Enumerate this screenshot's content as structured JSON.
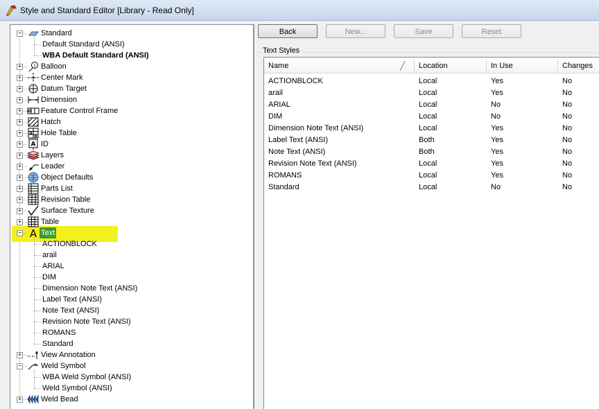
{
  "window": {
    "title": "Style and Standard Editor [Library - Read Only]"
  },
  "toolbar": {
    "back": "Back",
    "new": "New...",
    "save": "Save",
    "reset": "Reset"
  },
  "group": {
    "label": "Text Styles"
  },
  "list": {
    "columns": [
      "Name",
      "Location",
      "In Use",
      "Changes"
    ],
    "rows": [
      [
        "ACTIONBLOCK",
        "Local",
        "Yes",
        "No"
      ],
      [
        "arail",
        "Local",
        "Yes",
        "No"
      ],
      [
        "ARIAL",
        "Local",
        "No",
        "No"
      ],
      [
        "DIM",
        "Local",
        "No",
        "No"
      ],
      [
        "Dimension Note Text (ANSI)",
        "Local",
        "Yes",
        "No"
      ],
      [
        "Label Text (ANSI)",
        "Both",
        "Yes",
        "No"
      ],
      [
        "Note Text (ANSI)",
        "Both",
        "Yes",
        "No"
      ],
      [
        "Revision Note Text (ANSI)",
        "Local",
        "Yes",
        "No"
      ],
      [
        "ROMANS",
        "Local",
        "Yes",
        "No"
      ],
      [
        "Standard",
        "Local",
        "No",
        "No"
      ]
    ]
  },
  "tree": {
    "nodes": [
      {
        "label": "Standard",
        "icon": "standard-icon",
        "level": 0,
        "expander": "minus"
      },
      {
        "label": "Default Standard (ANSI)",
        "level": 1
      },
      {
        "label": "WBA Default Standard (ANSI)",
        "level": 1,
        "bold": true
      },
      {
        "label": "Balloon",
        "icon": "balloon-icon",
        "level": 0,
        "expander": "plus"
      },
      {
        "label": "Center Mark",
        "icon": "center-mark-icon",
        "level": 0,
        "expander": "plus"
      },
      {
        "label": "Datum Target",
        "icon": "datum-target-icon",
        "level": 0,
        "expander": "plus"
      },
      {
        "label": "Dimension",
        "icon": "dimension-icon",
        "level": 0,
        "expander": "plus"
      },
      {
        "label": "Feature Control Frame",
        "icon": "feature-control-frame-icon",
        "level": 0,
        "expander": "plus"
      },
      {
        "label": "Hatch",
        "icon": "hatch-icon",
        "level": 0,
        "expander": "plus"
      },
      {
        "label": "Hole Table",
        "icon": "hole-table-icon",
        "level": 0,
        "expander": "plus"
      },
      {
        "label": "ID",
        "icon": "id-icon",
        "level": 0,
        "expander": "plus"
      },
      {
        "label": "Layers",
        "icon": "layers-icon",
        "level": 0,
        "expander": "plus"
      },
      {
        "label": "Leader",
        "icon": "leader-icon",
        "level": 0,
        "expander": "plus"
      },
      {
        "label": "Object Defaults",
        "icon": "object-defaults-icon",
        "level": 0,
        "expander": "plus"
      },
      {
        "label": "Parts List",
        "icon": "parts-list-icon",
        "level": 0,
        "expander": "plus"
      },
      {
        "label": "Revision Table",
        "icon": "revision-table-icon",
        "level": 0,
        "expander": "plus"
      },
      {
        "label": "Surface Texture",
        "icon": "surface-texture-icon",
        "level": 0,
        "expander": "plus"
      },
      {
        "label": "Table",
        "icon": "table-icon",
        "level": 0,
        "expander": "plus"
      },
      {
        "label": "Text",
        "icon": "text-icon",
        "level": 0,
        "expander": "minus",
        "selected": true
      },
      {
        "label": "ACTIONBLOCK",
        "level": 1
      },
      {
        "label": "arail",
        "level": 1
      },
      {
        "label": "ARIAL",
        "level": 1
      },
      {
        "label": "DIM",
        "level": 1
      },
      {
        "label": "Dimension Note Text (ANSI)",
        "level": 1
      },
      {
        "label": "Label Text (ANSI)",
        "level": 1
      },
      {
        "label": "Note Text (ANSI)",
        "level": 1
      },
      {
        "label": "Revision Note Text (ANSI)",
        "level": 1
      },
      {
        "label": "ROMANS",
        "level": 1
      },
      {
        "label": "Standard",
        "level": 1
      },
      {
        "label": "View Annotation",
        "icon": "view-annotation-icon",
        "level": 0,
        "expander": "plus"
      },
      {
        "label": "Weld Symbol",
        "icon": "weld-symbol-icon",
        "level": 0,
        "expander": "minus"
      },
      {
        "label": "WBA Weld Symbol (ANSI)",
        "level": 1
      },
      {
        "label": "Weld Symbol (ANSI)",
        "level": 1
      },
      {
        "label": "Weld Bead",
        "icon": "weld-bead-icon",
        "level": 0,
        "expander": "plus"
      }
    ]
  },
  "colors": {
    "highlight": "#f4f01e",
    "selection": "#3d9b2a"
  }
}
